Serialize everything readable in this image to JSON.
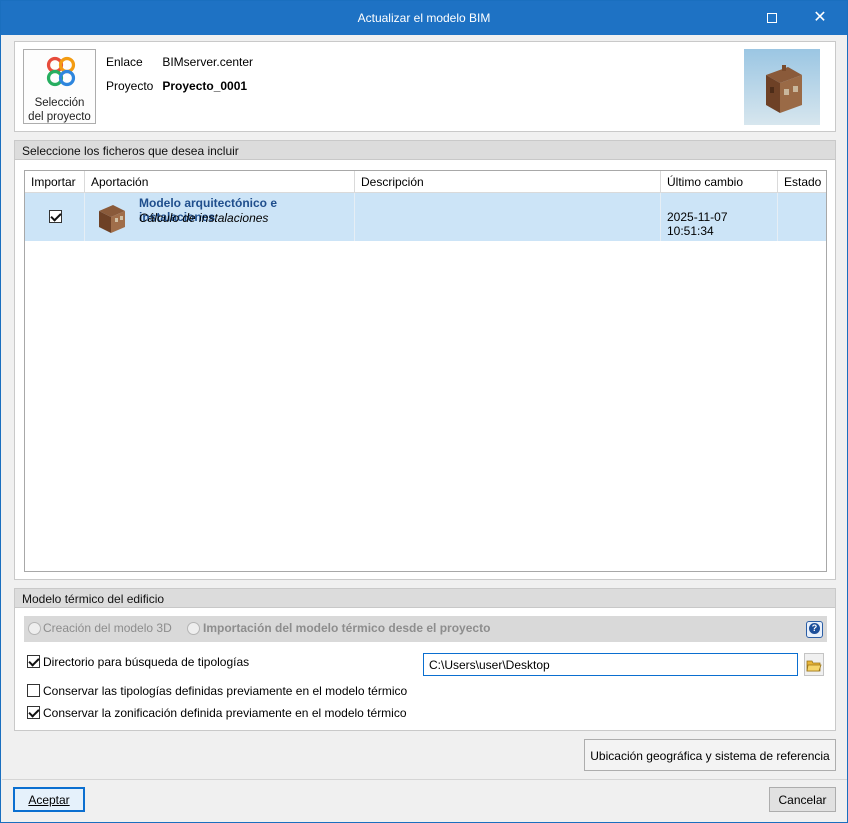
{
  "window": {
    "title": "Actualizar el modelo BIM"
  },
  "project_info": {
    "select_button_line1": "Selección",
    "select_button_line2": "del proyecto",
    "link_label": "Enlace",
    "link_value": "BIMserver.center",
    "project_label": "Proyecto",
    "project_value": "Proyecto_0001"
  },
  "files_section": {
    "title": "Seleccione los ficheros que desea incluir",
    "columns": [
      "Importar",
      "Aportación",
      "Descripción",
      "Último cambio",
      "Estado"
    ],
    "rows": [
      {
        "import": true,
        "title": "Modelo arquitectónico e instalaciones",
        "subtitle": "Cálculo de instalaciones",
        "description": "",
        "last_change": "2025-11-07 10:51:34",
        "status": ""
      }
    ]
  },
  "thermal_section": {
    "title": "Modelo térmico del edificio",
    "radio_option_1": "Creación del modelo 3D",
    "radio_option_2": "Importación del modelo térmico desde el proyecto",
    "selected_radio": 2,
    "help_icon": "question-icon",
    "directory_option": {
      "label": "Directorio para búsqueda de tipologías",
      "checked": true
    },
    "directory_path": "C:\\Users\\user\\Desktop",
    "keep_typologies": {
      "label": "Conservar las tipologías definidas previamente en el modelo térmico",
      "checked": false
    },
    "keep_zoning": {
      "label": "Conservar la zonificación definida previamente en el modelo térmico",
      "checked": true
    }
  },
  "buttons": {
    "geo_label": "Ubicación geográfica y sistema de referencia",
    "accept_label": "Aceptar",
    "cancel_label": "Cancelar"
  },
  "colors": {
    "titlebar": "#1e72c4",
    "row_selected": "#cce4f7",
    "model_title": "#1f4e8c"
  }
}
